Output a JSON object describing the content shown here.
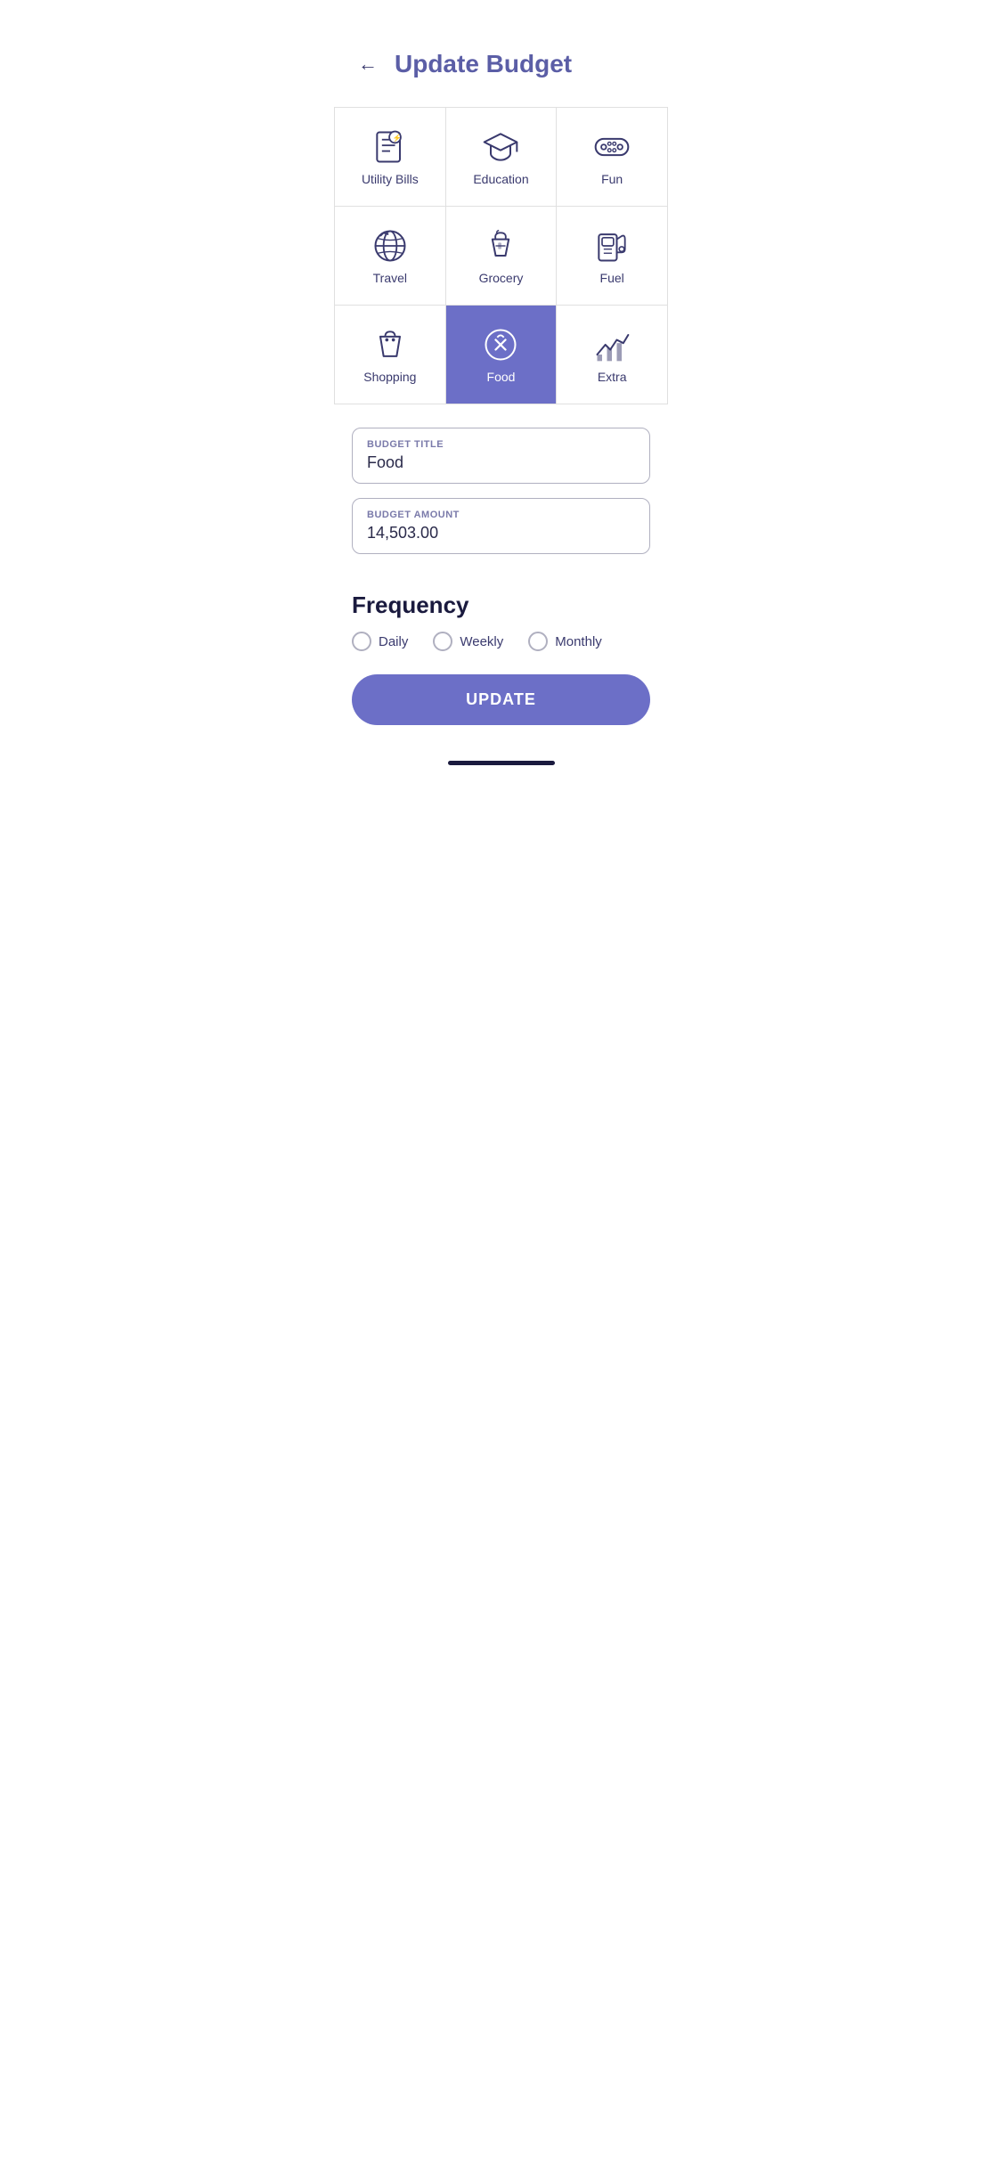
{
  "header": {
    "title": "Update Budget",
    "back_label": "←"
  },
  "categories": [
    {
      "id": "utility-bills",
      "label": "Utility Bills",
      "selected": false
    },
    {
      "id": "education",
      "label": "Education",
      "selected": false
    },
    {
      "id": "fun",
      "label": "Fun",
      "selected": false
    },
    {
      "id": "travel",
      "label": "Travel",
      "selected": false
    },
    {
      "id": "grocery",
      "label": "Grocery",
      "selected": false
    },
    {
      "id": "fuel",
      "label": "Fuel",
      "selected": false
    },
    {
      "id": "shopping",
      "label": "Shopping",
      "selected": false
    },
    {
      "id": "food",
      "label": "Food",
      "selected": true
    },
    {
      "id": "extra",
      "label": "Extra",
      "selected": false
    }
  ],
  "form": {
    "budget_title_label": "BUDGET TITLE",
    "budget_title_value": "Food",
    "budget_amount_label": "BUDGET AMOUNT",
    "budget_amount_value": "14,503.00"
  },
  "frequency": {
    "title": "Frequency",
    "options": [
      {
        "id": "daily",
        "label": "Daily",
        "checked": false
      },
      {
        "id": "weekly",
        "label": "Weekly",
        "checked": false
      },
      {
        "id": "monthly",
        "label": "Monthly",
        "checked": false
      }
    ]
  },
  "update_button": "UPDATE"
}
